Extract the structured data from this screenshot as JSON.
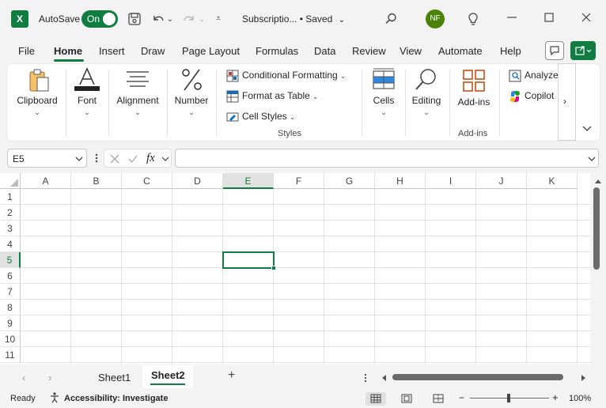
{
  "titlebar": {
    "autosave_label": "AutoSave",
    "autosave_state": "On",
    "doc_title": "Subscriptio...  •  Saved",
    "dropdown_caret": "⌄",
    "avatar_initials": "NF"
  },
  "tabs": [
    "File",
    "Home",
    "Insert",
    "Draw",
    "Page Layout",
    "Formulas",
    "Data",
    "Review",
    "View",
    "Automate",
    "Help"
  ],
  "ribbon": {
    "clipboard": "Clipboard",
    "font": "Font",
    "alignment": "Alignment",
    "number": "Number",
    "conditional_formatting": "Conditional Formatting",
    "format_as_table": "Format as Table",
    "cell_styles": "Cell Styles",
    "styles_group": "Styles",
    "cells": "Cells",
    "editing": "Editing",
    "addins_btn": "Add-ins",
    "addins_group": "Add-ins",
    "analyze": "Analyze",
    "copilot": "Copilot"
  },
  "formula_bar": {
    "name_box": "E5",
    "fx": "fx",
    "value": ""
  },
  "grid": {
    "columns": [
      "A",
      "B",
      "C",
      "D",
      "E",
      "F",
      "G",
      "H",
      "I",
      "J",
      "K"
    ],
    "rows": [
      "1",
      "2",
      "3",
      "4",
      "5",
      "6",
      "7",
      "8",
      "9",
      "10",
      "11"
    ],
    "selected_cell": "E5"
  },
  "sheets": {
    "tabs": [
      "Sheet1",
      "Sheet2"
    ],
    "active": "Sheet2",
    "add_label": "+"
  },
  "status": {
    "ready": "Ready",
    "accessibility": "Accessibility: Investigate",
    "zoom_minus": "−",
    "zoom_plus": "+",
    "zoom": "100%"
  },
  "colors": {
    "accent": "#107c41"
  }
}
